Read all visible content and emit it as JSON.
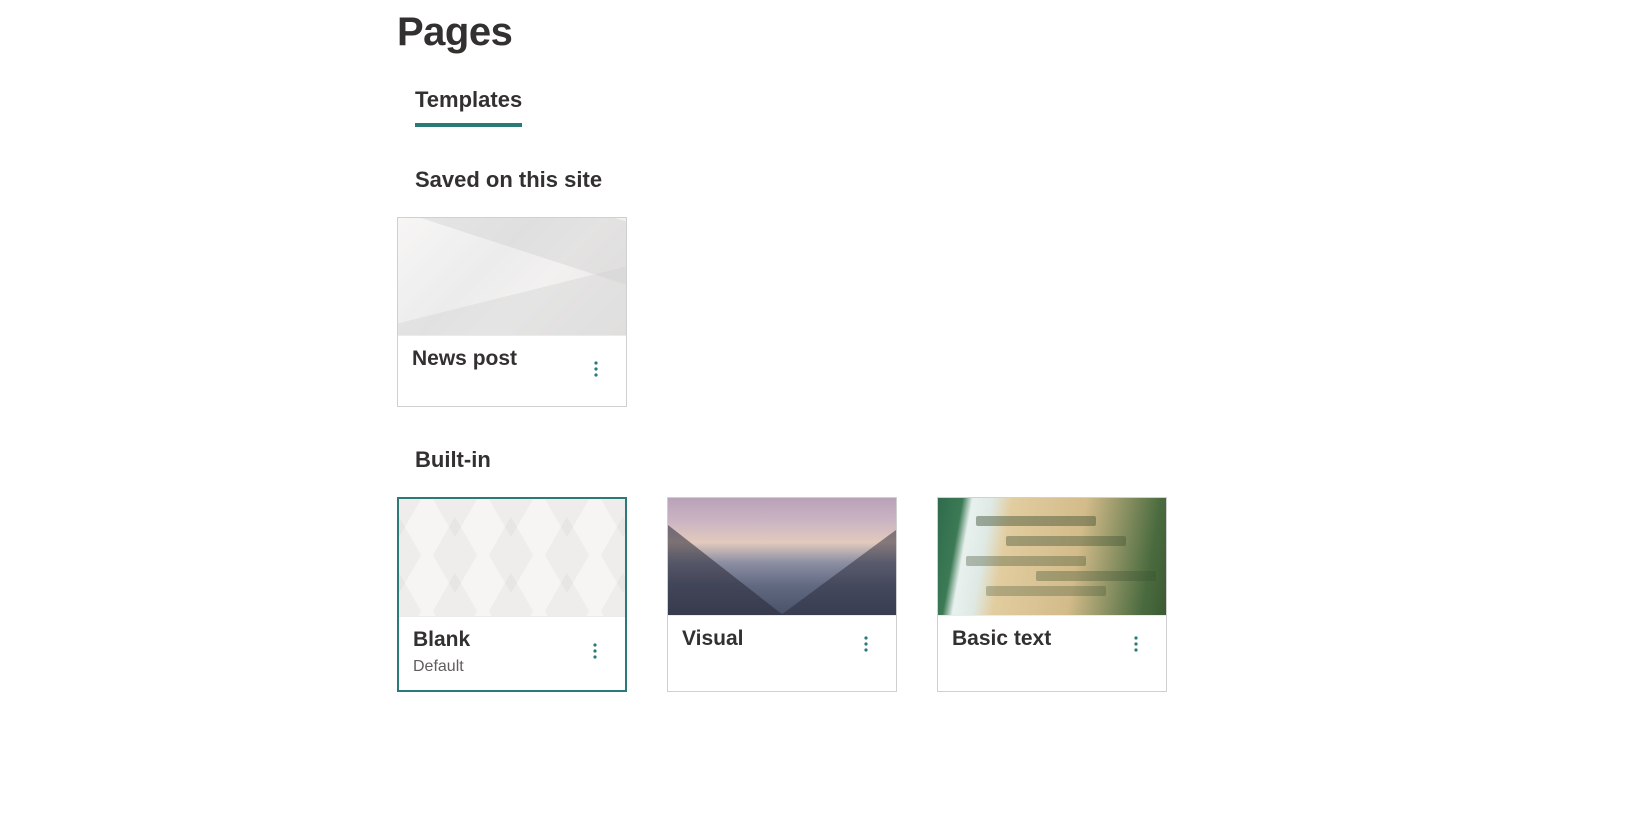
{
  "page": {
    "title": "Pages"
  },
  "tabs": {
    "active": "Templates"
  },
  "sections": {
    "saved": {
      "heading": "Saved on this site",
      "items": [
        {
          "title": "News post"
        }
      ]
    },
    "builtin": {
      "heading": "Built-in",
      "items": [
        {
          "title": "Blank",
          "subtitle": "Default",
          "selected": true
        },
        {
          "title": "Visual"
        },
        {
          "title": "Basic text"
        }
      ]
    }
  },
  "colors": {
    "accent": "#2b7a78"
  }
}
